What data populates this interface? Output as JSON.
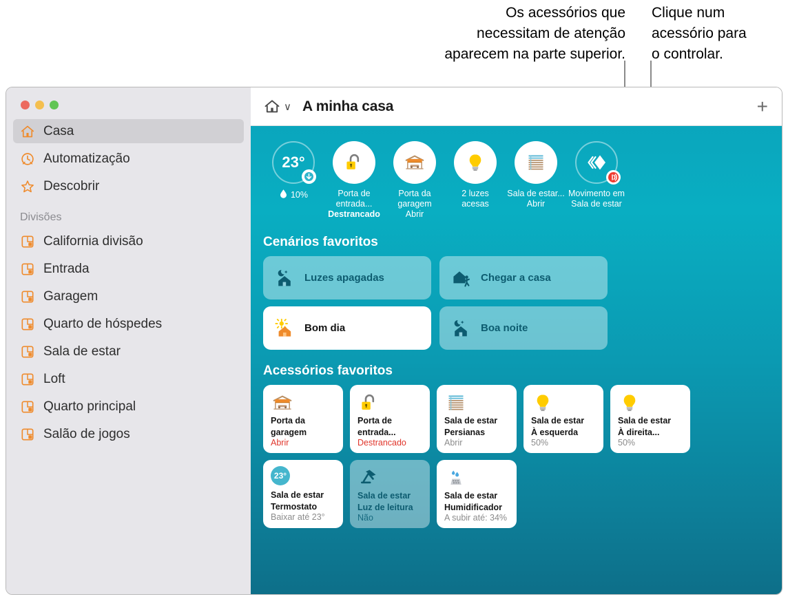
{
  "callouts": [
    {
      "id": "attention",
      "text": "Os acessórios que\nnecessitam de atenção\naparecem na parte superior."
    },
    {
      "id": "click",
      "text": "Clique num\nacessório para\no controlar."
    }
  ],
  "window": {
    "title": "A minha casa",
    "home_chevron": "∨",
    "add_label": "+"
  },
  "sidebar": {
    "items": [
      {
        "label": "Casa",
        "icon": "home-icon",
        "selected": true
      },
      {
        "label": "Automatização",
        "icon": "automation-clock-icon",
        "selected": false
      },
      {
        "label": "Descobrir",
        "icon": "star-icon",
        "selected": false
      }
    ],
    "section_title": "Divisões",
    "rooms": [
      {
        "label": "California divisão",
        "icon": "room-icon"
      },
      {
        "label": "Entrada",
        "icon": "room-icon"
      },
      {
        "label": "Garagem",
        "icon": "room-icon"
      },
      {
        "label": "Quarto de hóspedes",
        "icon": "room-icon"
      },
      {
        "label": "Sala de estar",
        "icon": "room-icon"
      },
      {
        "label": "Loft",
        "icon": "room-icon"
      },
      {
        "label": "Quarto principal",
        "icon": "room-icon"
      },
      {
        "label": "Salão de jogos",
        "icon": "room-icon"
      }
    ]
  },
  "status": {
    "items": [
      {
        "icon": "thermometer-circle",
        "temperature": "23°",
        "humidity": "10%",
        "line1": "",
        "line2": ""
      },
      {
        "icon": "unlocked-padlock-icon",
        "line1": "Porta de entrada...",
        "line2": "Destrancado"
      },
      {
        "icon": "garage-door-icon",
        "line1": "Porta da",
        "line2": "garagem",
        "line3": "Abrir"
      },
      {
        "icon": "lightbulb-icon",
        "line1": "2 luzes",
        "line2": "acesas"
      },
      {
        "icon": "blinds-icon",
        "line1": "Sala de estar...",
        "line2": "Abrir"
      },
      {
        "icon": "motion-sensor-icon",
        "line1": "Movimento em",
        "line2": "Sala de estar"
      }
    ]
  },
  "scenes": {
    "heading": "Cenários favoritos",
    "items": [
      {
        "label": "Luzes apagadas",
        "icon": "moon-house-icon",
        "active": false
      },
      {
        "label": "Chegar a casa",
        "icon": "house-person-icon",
        "active": false
      },
      {
        "label": "Bom dia",
        "icon": "sun-house-icon",
        "active": true
      },
      {
        "label": "Boa noite",
        "icon": "moon-house-icon",
        "active": false
      }
    ]
  },
  "accessories": {
    "heading": "Acessórios favoritos",
    "items": [
      {
        "icon": "garage-door-icon",
        "name_line1": "Porta da",
        "name_line2": "garagem",
        "state": "Abrir",
        "alert": true,
        "off": false
      },
      {
        "icon": "unlocked-padlock-icon",
        "name_line1": "Porta de",
        "name_line2": "entrada...",
        "state": "Destrancado",
        "alert": true,
        "off": false
      },
      {
        "icon": "blinds-icon",
        "name_line1": "Sala de estar",
        "name_line2": "Persianas",
        "state": "Abrir",
        "alert": false,
        "off": false
      },
      {
        "icon": "lightbulb-icon",
        "name_line1": "Sala de estar",
        "name_line2": "À esquerda",
        "state": "50%",
        "alert": false,
        "off": false
      },
      {
        "icon": "lightbulb-icon",
        "name_line1": "Sala de estar",
        "name_line2": "À direita...",
        "state": "50%",
        "alert": false,
        "off": false
      },
      {
        "icon": "thermostat-icon",
        "temp_badge": "23°",
        "name_line1": "Sala de estar",
        "name_line2": "Termostato",
        "state": "Baixar até 23°",
        "alert": false,
        "off": false
      },
      {
        "icon": "desk-lamp-icon",
        "name_line1": "Sala de estar",
        "name_line2": "Luz de leitura",
        "state": "Não",
        "alert": false,
        "off": true
      },
      {
        "icon": "humidifier-icon",
        "name_line1": "Sala de estar",
        "name_line2": "Humidificador",
        "state": "A subir até: 34%",
        "alert": false,
        "off": false
      }
    ]
  },
  "colors": {
    "accent_orange": "#ef8b2c",
    "teal_top": "#0aa6bd",
    "teal_bottom": "#0d6f89",
    "alert_red": "#e0352b",
    "scene_text": "#0d5c70",
    "yellow": "#ffcc00"
  }
}
